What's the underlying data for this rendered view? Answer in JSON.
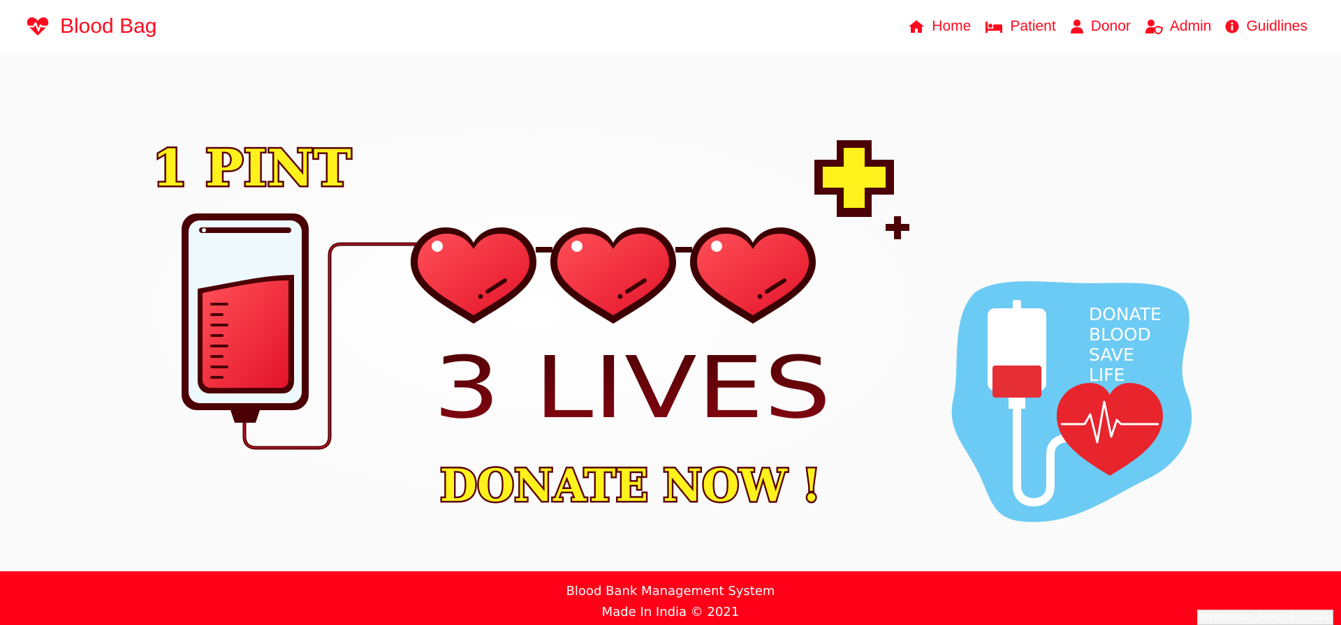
{
  "brand": {
    "name": "Blood Bag",
    "icon": "heartbeat-icon",
    "color": "#ff0a1f"
  },
  "nav": {
    "items": [
      {
        "label": "Home",
        "icon": "home-icon"
      },
      {
        "label": "Patient",
        "icon": "bed-icon"
      },
      {
        "label": "Donor",
        "icon": "user-icon"
      },
      {
        "label": "Admin",
        "icon": "user-shield-icon"
      },
      {
        "label": "Guidlines",
        "icon": "info-circle-icon"
      }
    ]
  },
  "hero": {
    "pint_text": "1 PINT",
    "lives_text": "3 LIVES",
    "donate_now_text": "DONATE NOW !",
    "badge_lines": [
      "DONATE",
      "BLOOD",
      "SAVE",
      "LIFE"
    ]
  },
  "footer": {
    "line1": "Blood Bank Management System",
    "line2": "Made In India © 2021",
    "background": "#ff0018"
  },
  "date_display": "Wednesday, March 17, 2021"
}
